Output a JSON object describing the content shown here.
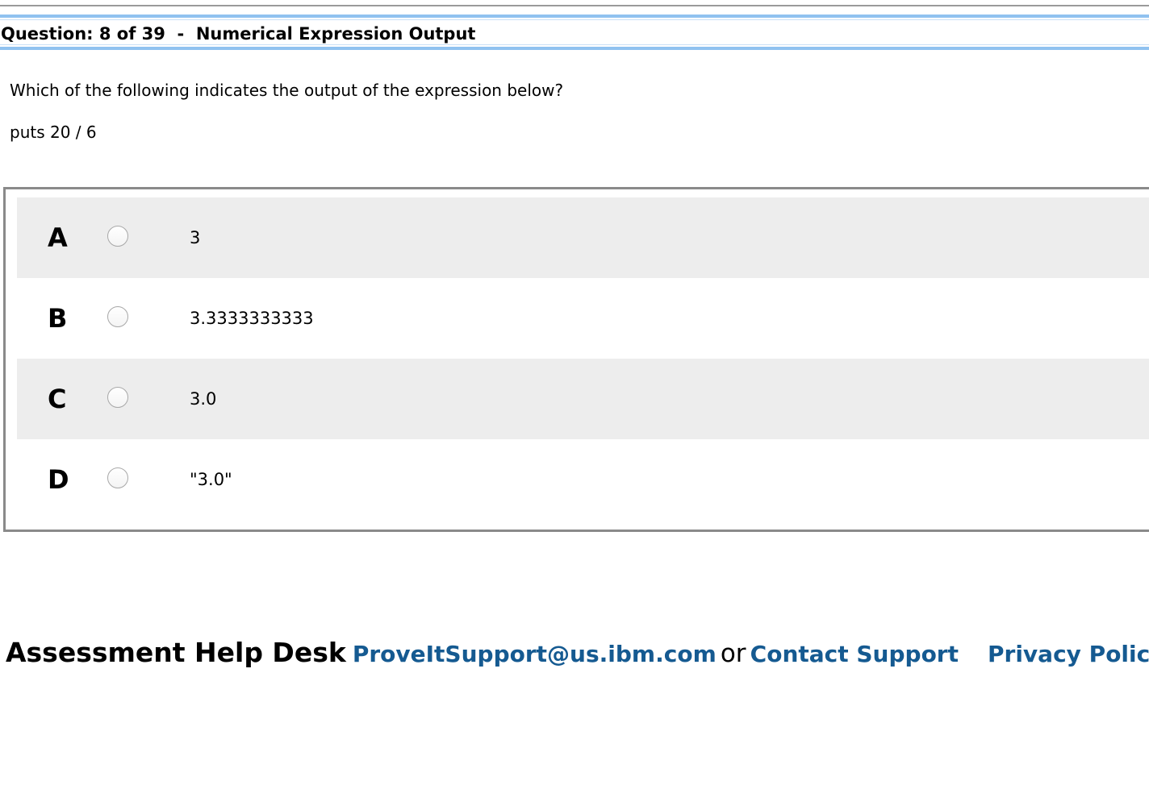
{
  "question": {
    "header": "Question: 8 of 39  -  Numerical Expression Output",
    "prompt": "Which of the following indicates the output of the expression below?",
    "code": "puts 20 / 6"
  },
  "answers": [
    {
      "letter": "A",
      "text": "3",
      "selected": false
    },
    {
      "letter": "B",
      "text": "3.3333333333",
      "selected": false
    },
    {
      "letter": "C",
      "text": "3.0",
      "selected": false
    },
    {
      "letter": "D",
      "text": "\"3.0\"",
      "selected": false
    }
  ],
  "footer": {
    "help_desk": "Assessment Help Desk",
    "email_link": "ProveItSupport@us.ibm.com",
    "or_text": "or",
    "contact_link": "Contact Support",
    "privacy_link": "Privacy Policy"
  },
  "colors": {
    "header_band": "#90c2f0",
    "row_shade": "#ededed",
    "link": "#155a91",
    "box_border": "#8a8a8a"
  }
}
